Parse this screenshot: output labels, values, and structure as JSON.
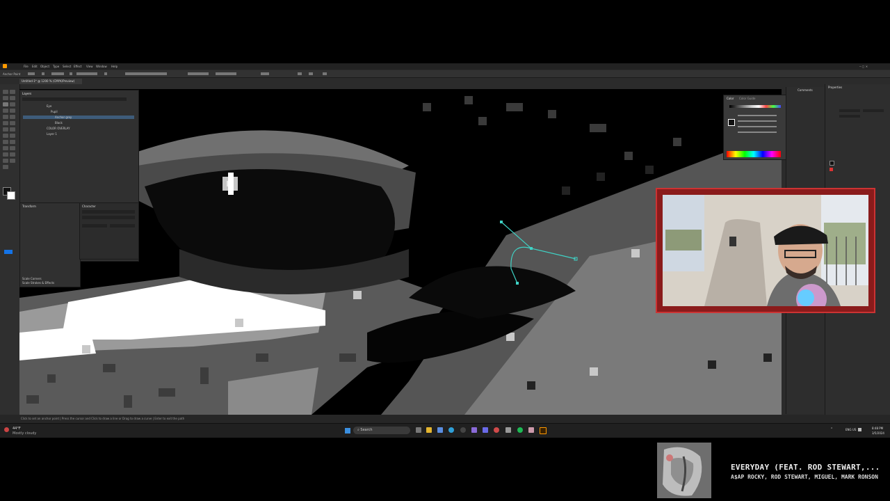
{
  "app": {
    "menu": [
      "File",
      "Edit",
      "Object",
      "Type",
      "Select",
      "Effect",
      "View",
      "Window",
      "Help"
    ],
    "doc_tab": "Untitled-1* @ 1200 % (CMYK/Preview)",
    "control_tool_label": "Anchor Point",
    "status_text": "Click to set an anchor point | Press the cursor and Click to draw a line or Drag to draw a curve | Enter to exit the path"
  },
  "layers_panel": {
    "title": "Layers",
    "rows": [
      "Eye",
      "Pupil",
      "Anchor grey",
      "Black",
      "COLOR OVERLAY",
      "Layer 1"
    ],
    "selected_index": 2
  },
  "tool_panels": {
    "transform_label": "Transform",
    "character_label": "Character",
    "scale_corners": "Scale Corners",
    "scale_strokes": "Scale Strokes & Effects"
  },
  "right_panels": {
    "color_tab": "Color",
    "color_guide_tab": "Color Guide",
    "comments_tab": "Comments",
    "properties_tab": "Properties"
  },
  "taskbar": {
    "weather_temp": "44°F",
    "weather_desc": "Mostly cloudy",
    "search_placeholder": "Search",
    "lang": "ENG US",
    "time": "8:48 PM",
    "date": "3/5/2024"
  },
  "now_playing": {
    "title": "EVERYDAY (FEAT. ROD STEWART,...",
    "artist": "A$AP ROCKY, ROD STEWART, MIGUEL, MARK RONSON"
  },
  "colors": {
    "path_accent": "#3fd3c6",
    "webcam_frame": "#c33333",
    "selection_blue": "#1473e6"
  }
}
